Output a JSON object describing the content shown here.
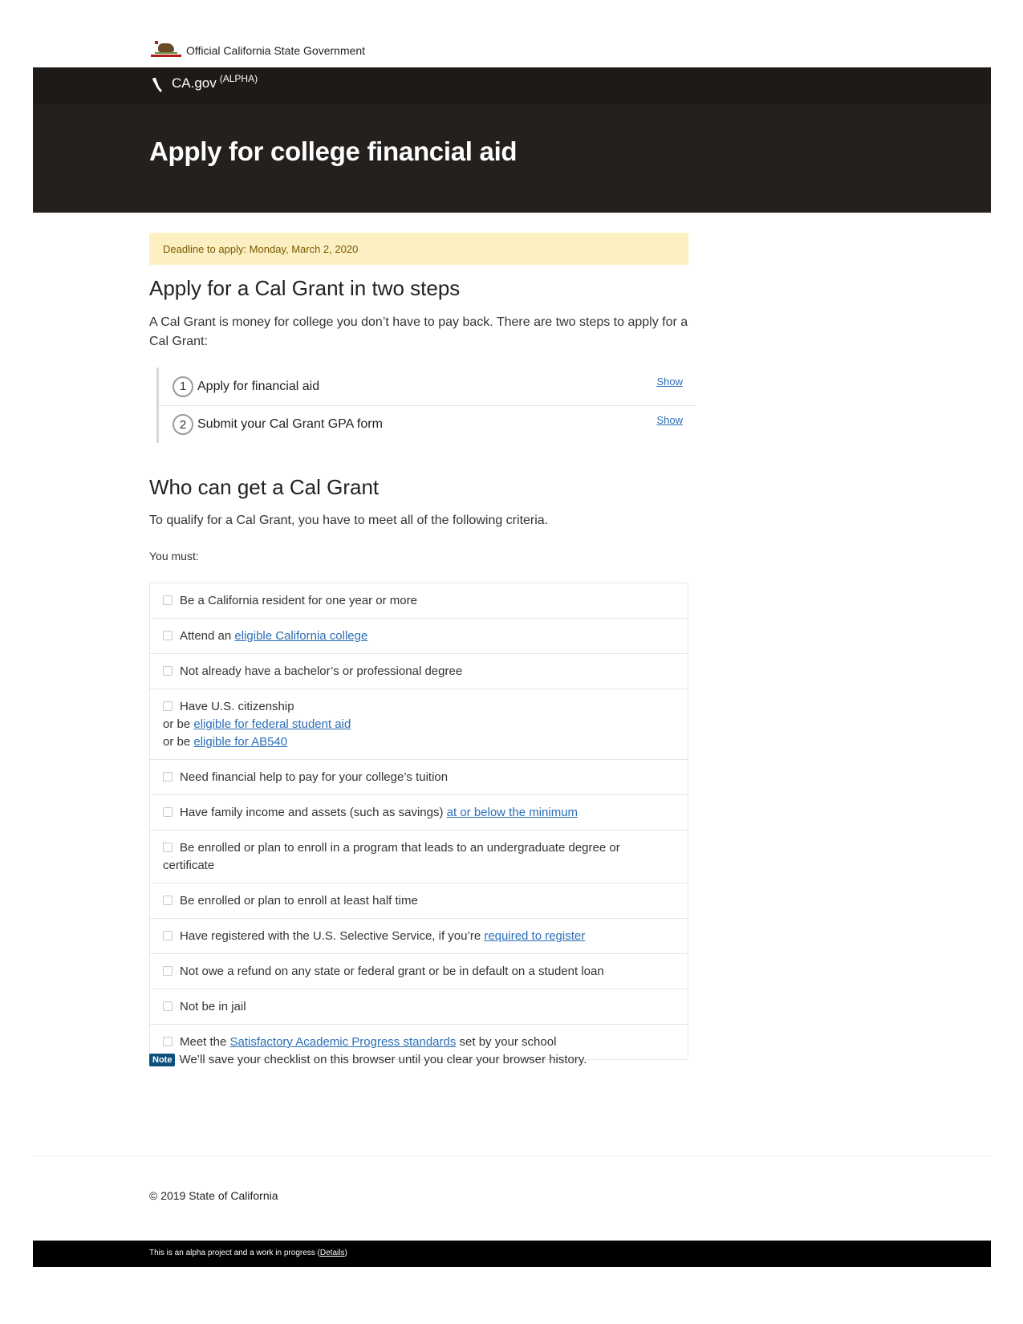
{
  "official_bar": {
    "text": "Official California State Government",
    "icon": "california-seal-icon"
  },
  "topnav": {
    "brand": "CA.gov",
    "tag": "(ALPHA)",
    "icon": "pen-nib-icon"
  },
  "header": {
    "title": "Apply for college financial aid"
  },
  "colors": {
    "header_bg": "#24201d",
    "deadline_bg": "#fcefc2",
    "link": "#2b6eb7",
    "note_badge": "#0f4f7f"
  },
  "deadline": "Deadline to apply: Monday, March 2, 2020",
  "steps_section": {
    "heading": "Apply for a Cal Grant in two steps",
    "intro": "A Cal Grant is money for college you don’t have to pay back. There are two steps to apply for a Cal Grant:",
    "steps": [
      {
        "num": "1",
        "label": "Apply for financial aid",
        "action": "Show"
      },
      {
        "num": "2",
        "label": "Submit your Cal Grant GPA form",
        "action": "Show"
      }
    ]
  },
  "who_section": {
    "heading": "Who can get a Cal Grant",
    "qualify": "To qualify for a Cal Grant, you have to meet all of the following criteria.",
    "must": "You must:",
    "criteria": [
      {
        "text": "Be a California resident for one year or more"
      },
      {
        "pre": "Attend an ",
        "link": "eligible California college"
      },
      {
        "text": "Not already have a bachelor’s or professional degree"
      },
      {
        "text": "Have U.S. citizenship",
        "line2_pre": "or be ",
        "line2_link": "eligible for federal student aid",
        "line3_pre": "or be ",
        "line3_link": "eligible for AB540"
      },
      {
        "text": "Need financial help to pay for your college’s tuition"
      },
      {
        "pre": "Have family income and assets (such as savings) ",
        "link": "at or below the minimum"
      },
      {
        "text": "Be enrolled or plan to enroll in a program that leads to an undergraduate degree or certificate"
      },
      {
        "text": "Be enrolled or plan to enroll at least half time"
      },
      {
        "pre": "Have registered with the U.S. Selective Service, if you’re ",
        "link": "required to register"
      },
      {
        "text": "Not owe a refund on any state or federal grant or be in default on a student loan"
      },
      {
        "text": "Not be in jail"
      },
      {
        "pre": "Meet the ",
        "link": "Satisfactory Academic Progress standards",
        "post": " set by your school"
      }
    ]
  },
  "note": {
    "badge": "Note",
    "text": "We’ll save your checklist on this browser until you clear your browser history."
  },
  "footer": {
    "copyright": "© 2019 State of California",
    "alpha_text": "This is an alpha project and a work in progress (",
    "alpha_link": "Details",
    "alpha_close": ")"
  }
}
